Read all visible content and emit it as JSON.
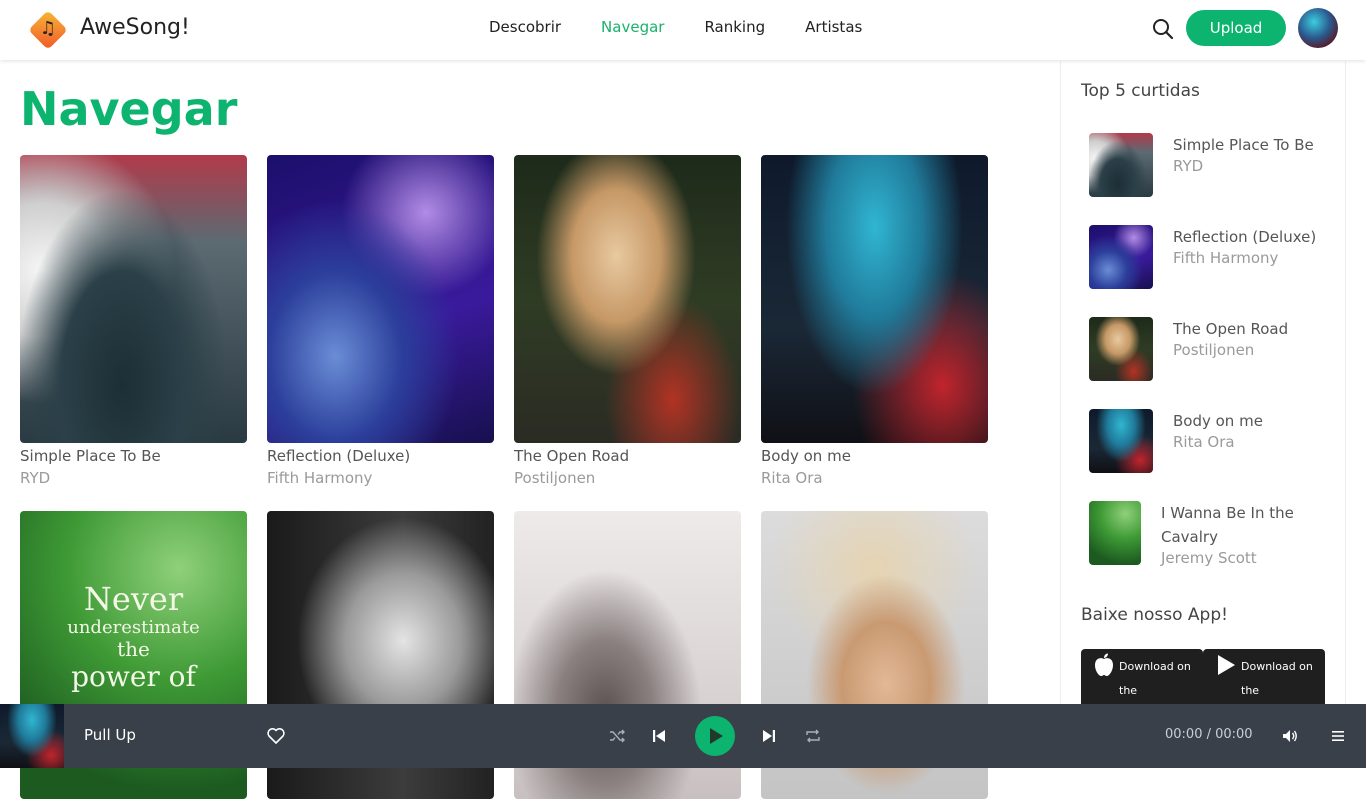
{
  "app": {
    "name": "AweSong!"
  },
  "header": {
    "nav": [
      "Descobrir",
      "Navegar",
      "Ranking",
      "Artistas"
    ],
    "active_nav": "Navegar",
    "upload_label": "Upload"
  },
  "main": {
    "title": "Navegar",
    "cards": [
      {
        "title": "Simple Place To Be",
        "artist": "RYD"
      },
      {
        "title": "Reflection (Deluxe)",
        "artist": "Fifth Harmony"
      },
      {
        "title": "The Open Road",
        "artist": "Postiljonen"
      },
      {
        "title": "Body on me",
        "artist": "Rita Ora"
      },
      {
        "title": "",
        "artist": "",
        "cover_text": [
          "Never",
          "underestimate",
          "the",
          "power of"
        ]
      },
      {
        "title": "",
        "artist": ""
      },
      {
        "title": "",
        "artist": ""
      },
      {
        "title": "",
        "artist": ""
      }
    ]
  },
  "sidebar": {
    "top_title": "Top 5 curtidas",
    "top": [
      {
        "title": "Simple Place To Be",
        "artist": "RYD"
      },
      {
        "title": "Reflection (Deluxe)",
        "artist": "Fifth Harmony"
      },
      {
        "title": "The Open Road",
        "artist": "Postiljonen"
      },
      {
        "title": "Body on me",
        "artist": "Rita Ora"
      },
      {
        "title": "I Wanna Be In the Cavalry",
        "artist": "Jeremy Scott"
      }
    ],
    "app_title": "Baixe nosso App!",
    "store_buttons": [
      {
        "label": "Download on the",
        "icon": "apple-icon"
      },
      {
        "label": "Download on the",
        "icon": "play-store-icon"
      }
    ]
  },
  "player": {
    "title": "Pull Up",
    "time": "00:00 / 00:00"
  },
  "colors": {
    "accent": "#0db46f",
    "player_bg": "#394049"
  }
}
